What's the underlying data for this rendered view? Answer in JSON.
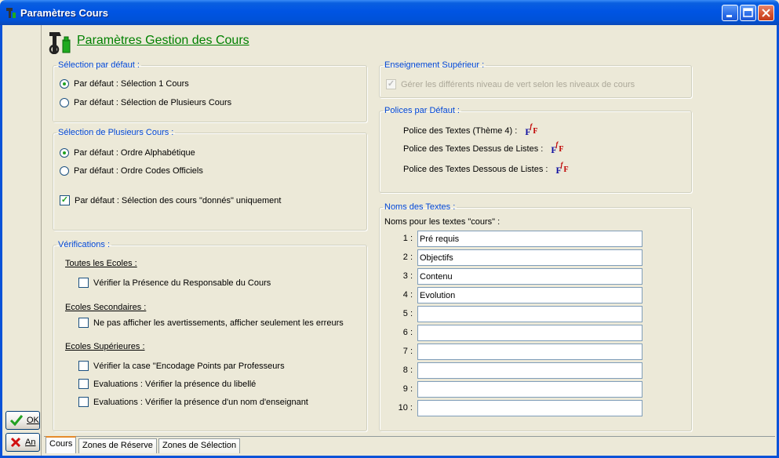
{
  "window": {
    "title": "Paramètres Cours",
    "icon": "tools-icon",
    "controls": [
      "minimize",
      "maximize",
      "close"
    ]
  },
  "header": {
    "title": "Paramètres Gestion des Cours"
  },
  "selection_defaut": {
    "legend": "Sélection par défaut :",
    "options": [
      {
        "label": "Par défaut : Sélection 1 Cours",
        "checked": true
      },
      {
        "label": "Par défaut : Sélection de Plusieurs Cours",
        "checked": false
      }
    ]
  },
  "selection_plusieurs": {
    "legend": "Sélection de Plusieurs Cours :",
    "options": [
      {
        "label": "Par défaut : Ordre Alphabétique",
        "checked": true
      },
      {
        "label": "Par défaut : Ordre Codes Officiels",
        "checked": false
      }
    ],
    "checkbox": {
      "label": "Par défaut : Sélection des cours \"donnés\" uniquement",
      "checked": true
    }
  },
  "verifications": {
    "legend": "Vérifications :",
    "toutes": {
      "heading": "Toutes les Ecoles :",
      "items": [
        {
          "label": "Vérifier la Présence du Responsable du Cours",
          "checked": false
        }
      ]
    },
    "secondaires": {
      "heading": "Ecoles Secondaires :",
      "items": [
        {
          "label": "Ne pas afficher les avertissements, afficher seulement les erreurs",
          "checked": false
        }
      ]
    },
    "superieures": {
      "heading": "Ecoles Supérieures :",
      "items": [
        {
          "label": "Vérifier la case \"Encodage Points par Professeurs",
          "checked": false
        },
        {
          "label": "Evaluations : Vérifier la présence du libellé",
          "checked": false
        },
        {
          "label": "Evaluations : Vérifier la présence d'un nom d'enseignant",
          "checked": false
        }
      ]
    }
  },
  "enseignement": {
    "legend": "Enseignement Supérieur :",
    "checkbox": {
      "label": "Gérer les différents niveau de vert selon les niveaux de cours",
      "checked": true,
      "disabled": true
    }
  },
  "polices": {
    "legend": "Polices par Défaut :",
    "items": [
      {
        "label": "Police des Textes (Thème 4) :",
        "icon": "font-icon"
      },
      {
        "label": "Police des Textes Dessus de Listes :",
        "icon": "font-icon"
      },
      {
        "label": "Police des Textes Dessous de Listes :",
        "icon": "font-icon"
      }
    ]
  },
  "noms": {
    "legend": "Noms des Textes :",
    "caption": "Noms pour les textes \"cours\" :",
    "fields": [
      {
        "num": "1 :",
        "value": "Pré requis"
      },
      {
        "num": "2 :",
        "value": "Objectifs"
      },
      {
        "num": "3 :",
        "value": "Contenu"
      },
      {
        "num": "4 :",
        "value": "Evolution"
      },
      {
        "num": "5 :",
        "value": ""
      },
      {
        "num": "6 :",
        "value": ""
      },
      {
        "num": "7 :",
        "value": ""
      },
      {
        "num": "8 :",
        "value": ""
      },
      {
        "num": "9 :",
        "value": ""
      },
      {
        "num": "10 :",
        "value": ""
      }
    ]
  },
  "buttons": {
    "ok": "OK",
    "cancel": "An"
  },
  "tabs": [
    {
      "label": "Cours",
      "active": true
    },
    {
      "label": "Zones de Réserve",
      "active": false
    },
    {
      "label": "Zones de Sélection",
      "active": false
    }
  ],
  "colors": {
    "title_bar": "#0054e3",
    "header_title": "#008000",
    "legend": "#0046d5",
    "face": "#ece9d8"
  }
}
